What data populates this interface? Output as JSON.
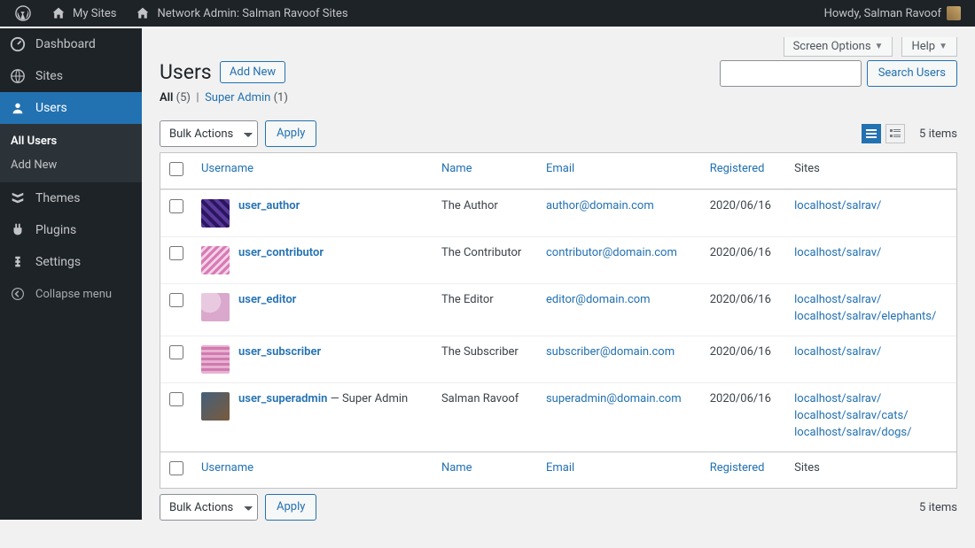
{
  "adminbar": {
    "mysites": "My Sites",
    "networkadmin": "Network Admin: Salman Ravoof Sites",
    "howdy": "Howdy, Salman Ravoof"
  },
  "sidebar": {
    "items": [
      {
        "label": "Dashboard"
      },
      {
        "label": "Sites"
      },
      {
        "label": "Users"
      },
      {
        "label": "Themes"
      },
      {
        "label": "Plugins"
      },
      {
        "label": "Settings"
      }
    ],
    "submenu": [
      {
        "label": "All Users"
      },
      {
        "label": "Add New"
      }
    ],
    "collapse": "Collapse menu"
  },
  "screen": {
    "options": "Screen Options",
    "help": "Help"
  },
  "page": {
    "title": "Users",
    "add_new": "Add New"
  },
  "filters": {
    "all_label": "All",
    "all_count": "(5)",
    "sep": "|",
    "super_label": "Super Admin",
    "super_count": "(1)"
  },
  "bulk": {
    "label": "Bulk Actions",
    "apply": "Apply"
  },
  "search": {
    "button": "Search Users"
  },
  "pagination": {
    "items": "5 items"
  },
  "columns": {
    "username": "Username",
    "name": "Name",
    "email": "Email",
    "registered": "Registered",
    "sites": "Sites"
  },
  "rows": [
    {
      "username": "user_author",
      "role_suffix": "",
      "name": "The Author",
      "email": "author@domain.com",
      "registered": "2020/06/16",
      "sites": [
        "localhost/salrav/"
      ],
      "avatar": "av1"
    },
    {
      "username": "user_contributor",
      "role_suffix": "",
      "name": "The Contributor",
      "email": "contributor@domain.com",
      "registered": "2020/06/16",
      "sites": [
        "localhost/salrav/"
      ],
      "avatar": "av2"
    },
    {
      "username": "user_editor",
      "role_suffix": "",
      "name": "The Editor",
      "email": "editor@domain.com",
      "registered": "2020/06/16",
      "sites": [
        "localhost/salrav/",
        "localhost/salrav/elephants/"
      ],
      "avatar": "av3"
    },
    {
      "username": "user_subscriber",
      "role_suffix": "",
      "name": "The Subscriber",
      "email": "subscriber@domain.com",
      "registered": "2020/06/16",
      "sites": [
        "localhost/salrav/"
      ],
      "avatar": "av4"
    },
    {
      "username": "user_superadmin",
      "role_suffix": " — Super Admin",
      "name": "Salman Ravoof",
      "email": "superadmin@domain.com",
      "registered": "2020/06/16",
      "sites": [
        "localhost/salrav/",
        "localhost/salrav/cats/",
        "localhost/salrav/dogs/"
      ],
      "avatar": "av5"
    }
  ]
}
